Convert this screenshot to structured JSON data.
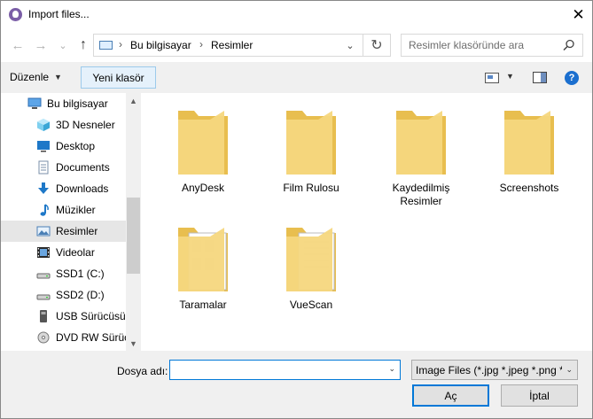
{
  "window": {
    "title": "Import files...",
    "close_glyph": "✕"
  },
  "nav": {
    "back_glyph": "←",
    "forward_glyph": "→",
    "recent_glyph": "⌄",
    "up_glyph": "↑",
    "breadcrumb": [
      "Bu bilgisayar",
      "Resimler"
    ],
    "separator": "›",
    "dropdown_glyph": "⌄",
    "refresh_glyph": "↻",
    "search_placeholder": "Resimler klasöründe ara"
  },
  "toolbar": {
    "organize_label": "Düzenle",
    "caret": "▼",
    "new_folder_label": "Yeni klasör",
    "help_label": "?"
  },
  "sidebar": {
    "items": [
      {
        "label": "Bu bilgisayar",
        "icon": "computer-icon",
        "selected": false
      },
      {
        "label": "3D Nesneler",
        "icon": "3d-objects-icon",
        "selected": false
      },
      {
        "label": "Desktop",
        "icon": "desktop-icon",
        "selected": false
      },
      {
        "label": "Documents",
        "icon": "documents-icon",
        "selected": false
      },
      {
        "label": "Downloads",
        "icon": "downloads-icon",
        "selected": false
      },
      {
        "label": "Müzikler",
        "icon": "music-icon",
        "selected": false
      },
      {
        "label": "Resimler",
        "icon": "pictures-icon",
        "selected": true
      },
      {
        "label": "Videolar",
        "icon": "videos-icon",
        "selected": false
      },
      {
        "label": "SSD1 (C:)",
        "icon": "drive-icon",
        "selected": false
      },
      {
        "label": "SSD2 (D:)",
        "icon": "drive-icon",
        "selected": false
      },
      {
        "label": "USB Sürücüsü (",
        "icon": "usb-drive-icon",
        "selected": false
      },
      {
        "label": "DVD RW Sürüc",
        "icon": "dvd-drive-icon",
        "selected": false
      }
    ],
    "scroll_up_glyph": "▲",
    "scroll_down_glyph": "▼"
  },
  "content": {
    "folders": [
      {
        "label": "AnyDesk",
        "kind": "plain"
      },
      {
        "label": "Film Rulosu",
        "kind": "plain"
      },
      {
        "label": "Kaydedilmiş Resimler",
        "kind": "plain"
      },
      {
        "label": "Screenshots",
        "kind": "plain"
      },
      {
        "label": "Taramalar",
        "kind": "with-scans"
      },
      {
        "label": "VueScan",
        "kind": "with-docs"
      }
    ]
  },
  "bottom": {
    "filename_label": "Dosya adı:",
    "filename_value": "",
    "dropdown_glyph": "⌄",
    "filetype_value": "Image Files (*.jpg *.jpeg *.png *",
    "open_label": "Aç",
    "cancel_label": "İptal"
  },
  "colors": {
    "accent": "#0078d7",
    "folder": "#f5d77e",
    "folder_dark": "#e8be4f",
    "selected_bg": "#e6e6e6"
  }
}
